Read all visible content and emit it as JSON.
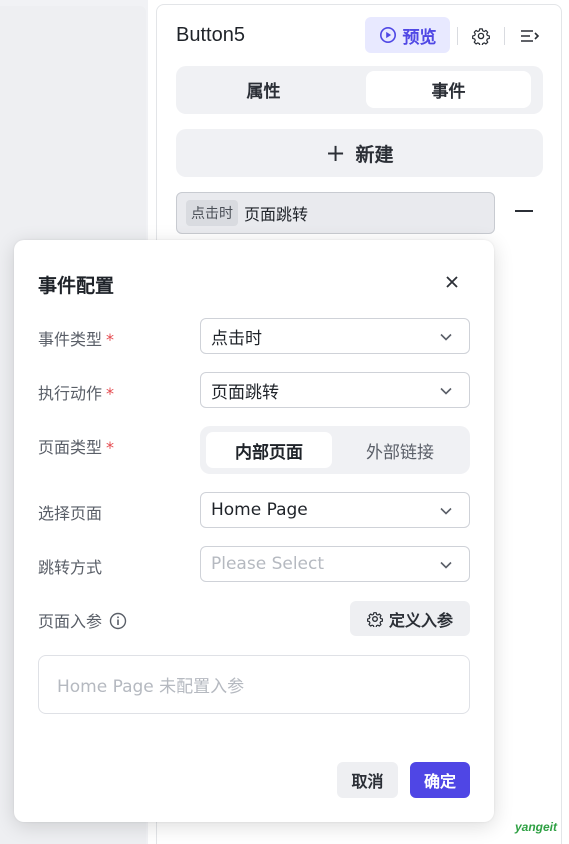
{
  "panel": {
    "title": "Button5",
    "preview_label": "预览",
    "tabs": [
      {
        "label": "属性",
        "active": false
      },
      {
        "label": "事件",
        "active": true
      }
    ],
    "new_label": "新建",
    "event_item": {
      "trigger": "点击时",
      "action": "页面跳转"
    }
  },
  "modal": {
    "title": "事件配置",
    "fields": {
      "event_type": {
        "label": "事件类型",
        "value": "点击时"
      },
      "action": {
        "label": "执行动作",
        "value": "页面跳转"
      },
      "page_type": {
        "label": "页面类型",
        "options": [
          "内部页面",
          "外部链接"
        ],
        "selected": "内部页面"
      },
      "page_select": {
        "label": "选择页面",
        "value": "Home Page"
      },
      "jump_mode": {
        "label": "跳转方式",
        "placeholder": "Please Select"
      },
      "params": {
        "label": "页面入参",
        "define_label": "定义入参",
        "empty_text": "Home Page 未配置入参"
      }
    },
    "required_mark": "*",
    "cancel_label": "取消",
    "ok_label": "确定"
  },
  "watermark": "yangeit",
  "colors": {
    "accent": "#4f46e5",
    "required": "#e5484d",
    "preview_bg": "#e8e9ff"
  }
}
